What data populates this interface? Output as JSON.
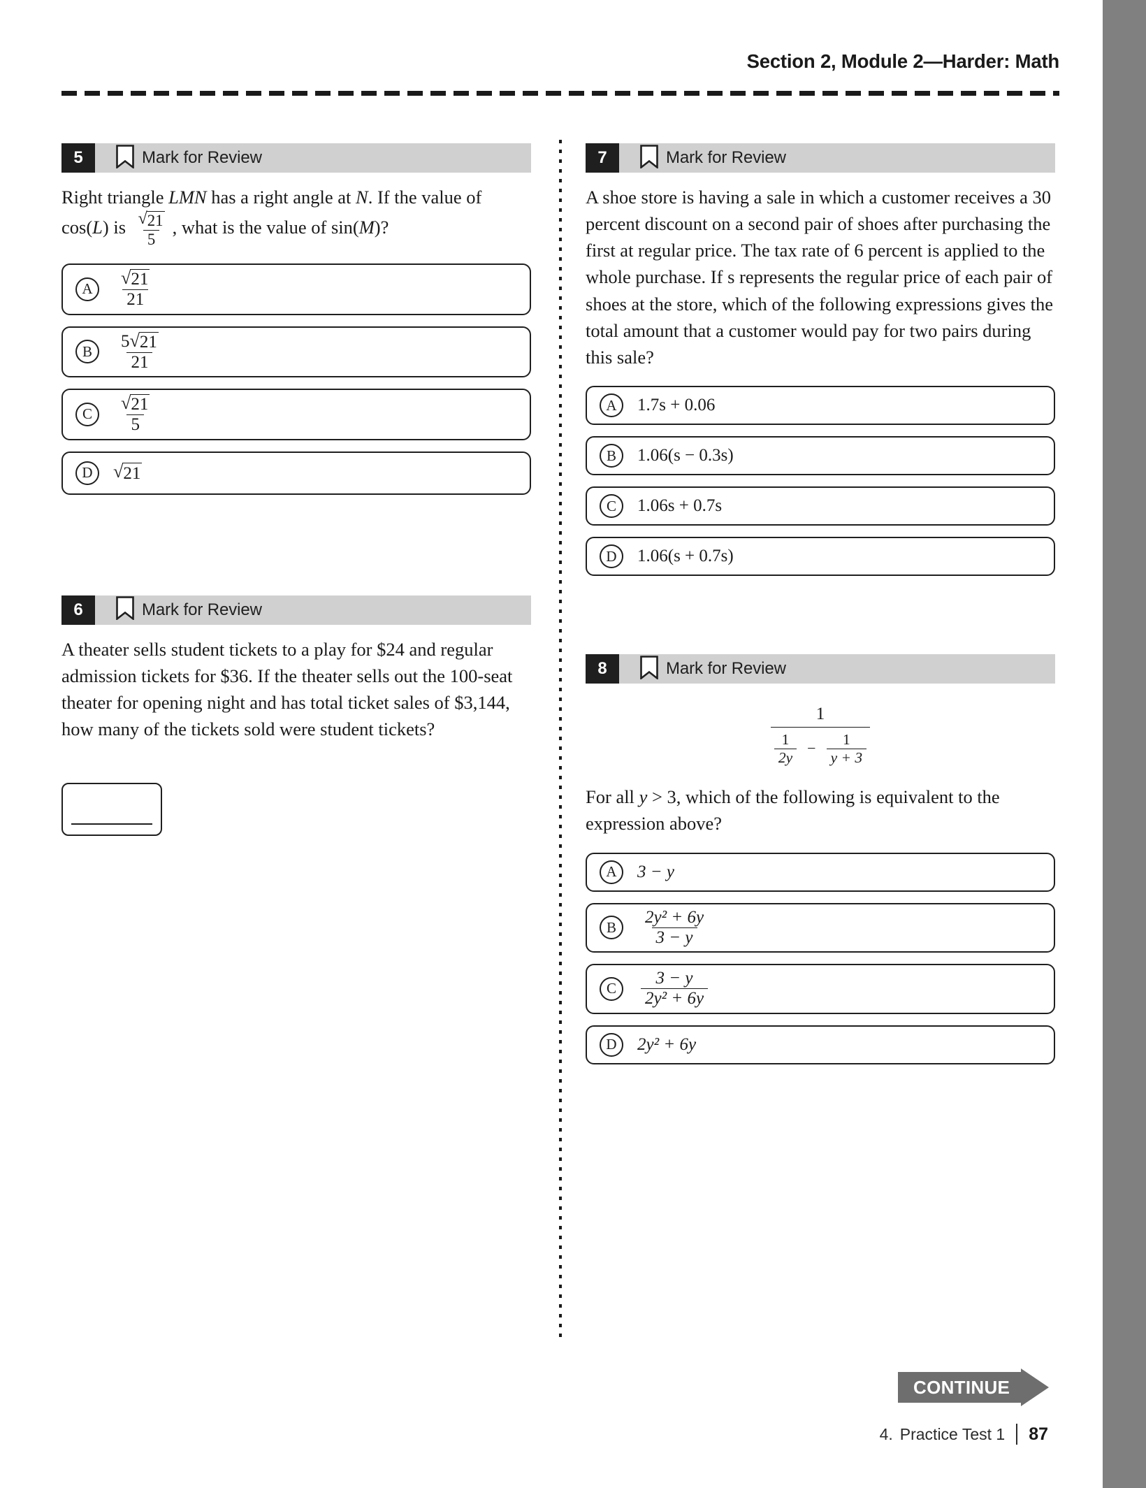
{
  "header": {
    "running_head": "Section 2, Module 2—Harder: Math"
  },
  "mark_for_review_label": "Mark for Review",
  "questions": [
    {
      "number": "5",
      "column": "left",
      "type": "multiple-choice",
      "stem_parts": {
        "p1": "Right triangle ",
        "var_lmn": "LMN",
        "p2": " has a right angle at ",
        "var_n": "N",
        "p3": ". If the value of cos(",
        "var_l": "L",
        "p4": ") is ",
        "frac_num_radicand": "21",
        "frac_den": "5",
        "p5": ", what is the value of sin(",
        "var_m": "M",
        "p6": ")?"
      },
      "choices": [
        {
          "letter": "A",
          "text": "sqrt(21)/21",
          "numerator_coef": "",
          "numerator_radicand": "21",
          "denominator": "21"
        },
        {
          "letter": "B",
          "text": "5*sqrt(21)/21",
          "numerator_coef": "5",
          "numerator_radicand": "21",
          "denominator": "21"
        },
        {
          "letter": "C",
          "text": "sqrt(21)/5",
          "numerator_coef": "",
          "numerator_radicand": "21",
          "denominator": "5"
        },
        {
          "letter": "D",
          "text": "sqrt(21)",
          "numerator_coef": "",
          "numerator_radicand": "21",
          "denominator": ""
        }
      ]
    },
    {
      "number": "6",
      "column": "left",
      "type": "student-produced-response",
      "stem": "A theater sells student tickets to a play for $24 and regular admission tickets for $36. If the theater sells out the 100-seat theater for opening night and has total ticket sales of $3,144, how many of the tickets sold were student tickets?",
      "answer_value": ""
    },
    {
      "number": "7",
      "column": "right",
      "type": "multiple-choice",
      "stem": "A shoe store is having a sale in which a customer receives a 30 percent discount on a second pair of shoes after purchasing the first at regular price. The tax rate of 6 percent is applied to the whole purchase. If s represents the regular price of each pair of shoes at the store, which of the following expressions gives the total amount that a customer would pay for two pairs during this sale?",
      "choices": [
        {
          "letter": "A",
          "text": "1.7s + 0.06"
        },
        {
          "letter": "B",
          "text": "1.06(s − 0.3s)"
        },
        {
          "letter": "C",
          "text": "1.06s + 0.7s"
        },
        {
          "letter": "D",
          "text": "1.06(s + 0.7s)"
        }
      ]
    },
    {
      "number": "8",
      "column": "right",
      "type": "multiple-choice",
      "expression": {
        "numerator": "1",
        "denominator_left_num": "1",
        "denominator_left_den": "2y",
        "operator": "−",
        "denominator_right_num": "1",
        "denominator_right_den": "y + 3"
      },
      "stem_parts": {
        "p1": "For all ",
        "var_y": "y",
        "p2": " > 3, which of the following is equivalent to the expression above?"
      },
      "choices": [
        {
          "letter": "A",
          "text": "3 − y"
        },
        {
          "letter": "B",
          "numerator": "2y² + 6y",
          "denominator": "3 − y"
        },
        {
          "letter": "C",
          "numerator": "3 − y",
          "denominator": "2y² + 6y"
        },
        {
          "letter": "D",
          "text": "2y² + 6y"
        }
      ]
    }
  ],
  "footer": {
    "continue_label": "CONTINUE",
    "chapter": "4.",
    "book_title": "Practice Test 1",
    "page_number": "87"
  },
  "colors": {
    "qhead_bg": "#d0d0d0",
    "qnum_bg": "#1f1f1f",
    "continue_bg": "#6e6e6e",
    "edge_bar": "#808080",
    "text": "#1a1a1a"
  }
}
